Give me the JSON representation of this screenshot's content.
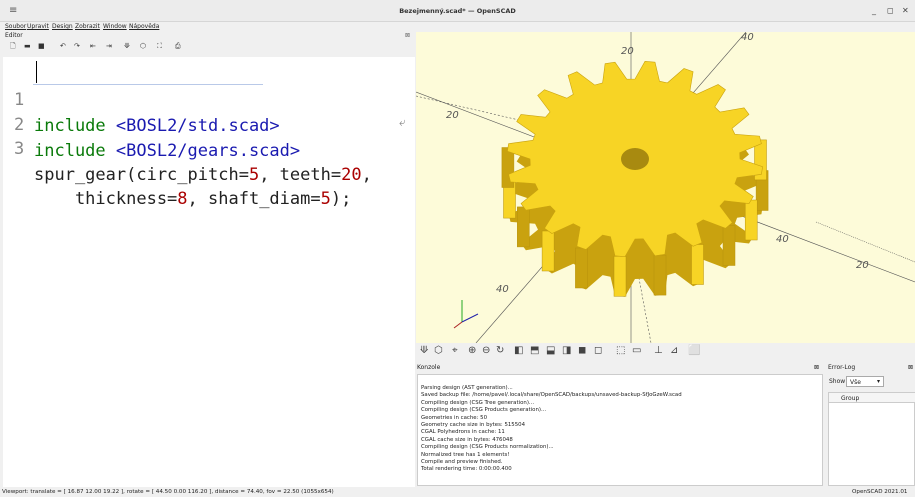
{
  "window": {
    "title": "Bezejmenný.scad* — OpenSCAD",
    "menu_icon": "hamburger-icon",
    "controls": [
      "_",
      "◻",
      "✕"
    ]
  },
  "menubar": [
    "Soubor",
    "Upravit",
    "Design",
    "Zobrazit",
    "Window",
    "Nápověda"
  ],
  "editor": {
    "label": "Editor",
    "close": "⊠",
    "toolbar_icons": [
      "new-file-icon",
      "open-file-icon",
      "save-icon",
      "undo-icon",
      "redo-icon",
      "unindent-icon",
      "indent-icon",
      "preview-icon",
      "render-icon",
      "export-stl-icon",
      "send-to-print-icon"
    ],
    "lines": [
      {
        "n": "1",
        "parts": [
          [
            "kw",
            "include "
          ],
          [
            "str",
            "<BOSL2/std.scad>"
          ]
        ]
      },
      {
        "n": "2",
        "parts": [
          [
            "kw",
            "include "
          ],
          [
            "str",
            "<BOSL2/gears.scad>"
          ]
        ]
      },
      {
        "n": "3",
        "parts": [
          [
            "plain",
            "spur_gear(circ_pitch="
          ],
          [
            "num",
            "5"
          ],
          [
            "plain",
            ", teeth="
          ],
          [
            "num",
            "20"
          ],
          [
            "plain",
            ","
          ]
        ]
      },
      {
        "n": "",
        "parts": [
          [
            "plain",
            "    thickness="
          ],
          [
            "num",
            "8"
          ],
          [
            "plain",
            ", shaft_diam="
          ],
          [
            "num",
            "5"
          ],
          [
            "plain",
            ");"
          ]
        ]
      }
    ]
  },
  "viewport": {
    "background": "#fdfbd9",
    "gear_color": "#f7d425",
    "gear_dark": "#c9a20f",
    "axis_labels": [
      "20",
      "40",
      "20",
      "40",
      "20",
      "40"
    ]
  },
  "viewport_toolbar_icons": [
    "preview-icon",
    "render-icon",
    "view-all-icon",
    "zoom-in-icon",
    "zoom-out-icon",
    "reset-view-icon",
    "right-view-icon",
    "top-view-icon",
    "bottom-view-icon",
    "left-view-icon",
    "front-view-icon",
    "back-view-icon",
    "perspective-icon",
    "orthogonal-icon",
    "show-axes-icon",
    "show-scale-icon",
    "show-edges-icon"
  ],
  "console": {
    "label": "Konzole",
    "close": "⊠",
    "lines": [
      "Parsing design (AST generation)...",
      "Saved backup file: /home/pavel/.local/share/OpenSCAD/backups/unsaved-backup-SfJoGzeW.scad",
      "Compiling design (CSG Tree generation)...",
      "Compiling design (CSG Products generation)...",
      "Geometries in cache: 50",
      "Geometry cache size in bytes: 515504",
      "CGAL Polyhedrons in cache: 11",
      "CGAL cache size in bytes: 476048",
      "Compiling design (CSG Products normalization)...",
      "Normalized tree has 1 elements!",
      "Compile and preview finished.",
      "Total rendering time: 0:00:00.400"
    ]
  },
  "errorlog": {
    "label": "Error-Log",
    "close": "⊠",
    "show_label": "Show",
    "show_value": "Vše",
    "column": "Group"
  },
  "statusbar": {
    "left": "Viewport: translate = [ 16.87 12.00 19.22 ], rotate = [ 44.50 0.00 116.20 ], distance = 74.40, fov = 22.50 (1055x654)",
    "right": "OpenSCAD 2021.01"
  }
}
